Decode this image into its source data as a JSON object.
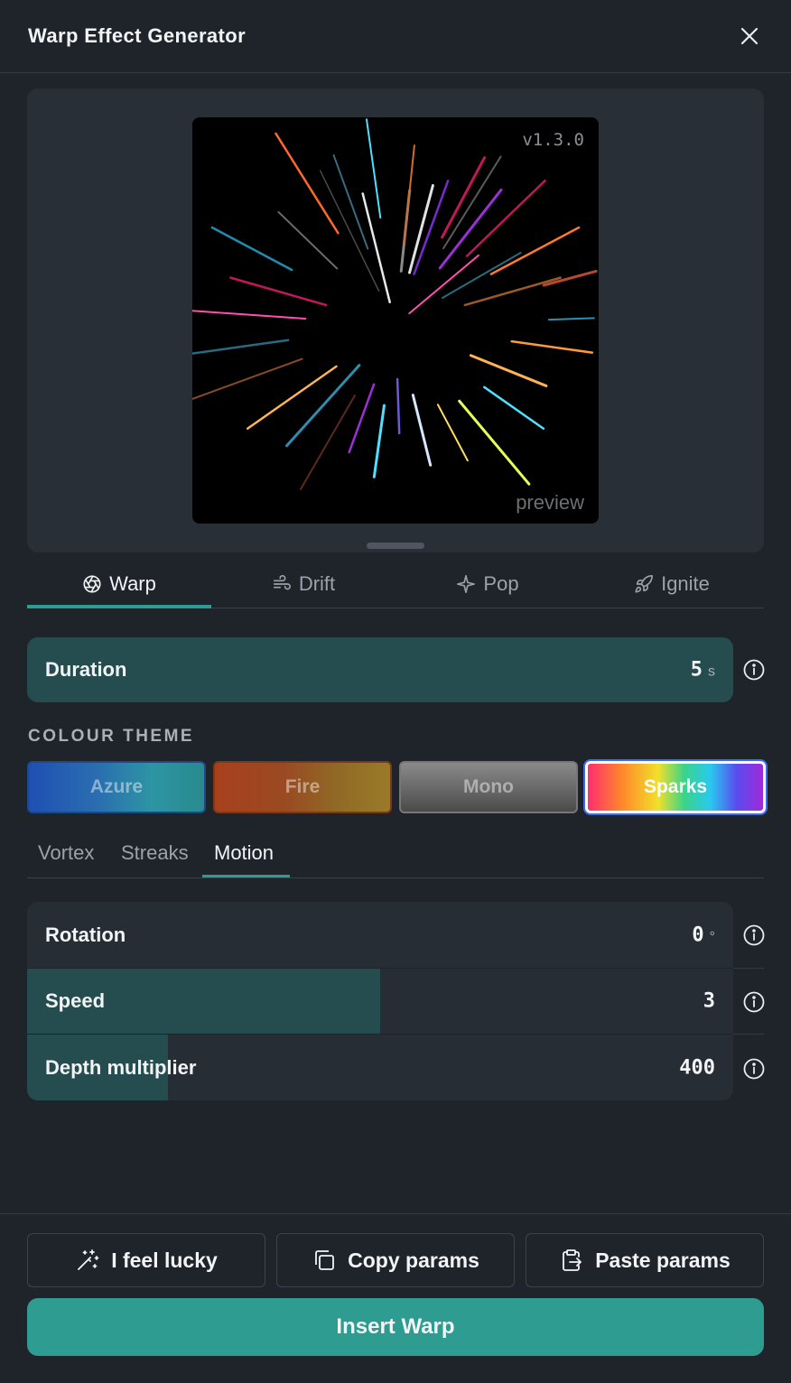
{
  "dialog": {
    "title": "Warp Effect Generator"
  },
  "preview": {
    "version": "v1.3.0",
    "label": "preview"
  },
  "tabs": [
    {
      "label": "Warp",
      "icon": "aperture-icon",
      "active": true
    },
    {
      "label": "Drift",
      "icon": "wind-icon",
      "active": false
    },
    {
      "label": "Pop",
      "icon": "sparkle-icon",
      "active": false
    },
    {
      "label": "Ignite",
      "icon": "rocket-icon",
      "active": false
    }
  ],
  "duration": {
    "label": "Duration",
    "value": "5",
    "unit": "s",
    "fill_fraction": 1.0
  },
  "colour_theme": {
    "label": "COLOUR THEME",
    "options": [
      {
        "label": "Azure",
        "selected": false
      },
      {
        "label": "Fire",
        "selected": false
      },
      {
        "label": "Mono",
        "selected": false
      },
      {
        "label": "Sparks",
        "selected": true
      }
    ]
  },
  "subtabs": [
    {
      "label": "Vortex",
      "active": false
    },
    {
      "label": "Streaks",
      "active": false
    },
    {
      "label": "Motion",
      "active": true
    }
  ],
  "motion": {
    "rotation": {
      "label": "Rotation",
      "value": "0",
      "unit": "°",
      "fill_fraction": 0.0
    },
    "speed": {
      "label": "Speed",
      "value": "3",
      "fill_fraction": 0.5
    },
    "depth": {
      "label": "Depth multiplier",
      "value": "400",
      "fill_fraction": 0.2
    }
  },
  "actions": {
    "lucky": "I feel lucky",
    "copy": "Copy params",
    "paste": "Paste params",
    "insert": "Insert Warp"
  },
  "colors": {
    "accent": "#2e9c90",
    "background": "#1f242b",
    "panel": "#272d35",
    "slider_fill": "#254c4f"
  }
}
